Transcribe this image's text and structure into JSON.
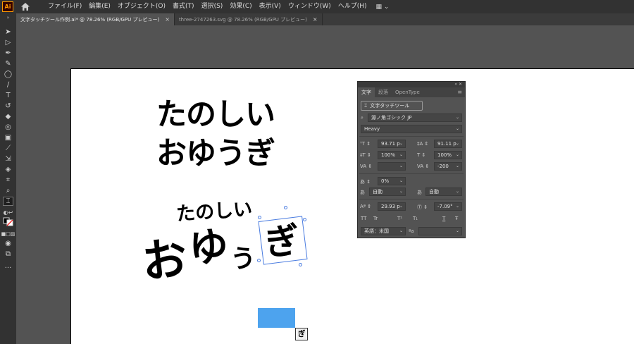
{
  "app": {
    "logo": "Ai"
  },
  "menu": {
    "items": [
      "ファイル(F)",
      "編集(E)",
      "オブジェクト(O)",
      "書式(T)",
      "選択(S)",
      "効果(C)",
      "表示(V)",
      "ウィンドウ(W)",
      "ヘルプ(H)"
    ]
  },
  "tabs": [
    {
      "label": "文字タッチツール作例.ai* @ 78.26% (RGB/GPU プレビュー)",
      "close": "×"
    },
    {
      "label": "three-2747263.svg @ 78.26% (RGB/GPU プレビュー)",
      "close": "×"
    }
  ],
  "artwork": {
    "line1": "たのしい",
    "line2": "おゆうぎ",
    "touch_line1": "たのしい",
    "touch_o": "お",
    "touch_yu": "ゆ",
    "touch_u": "う",
    "touch_gi": "ぎ",
    "tag": "ぎ"
  },
  "panel": {
    "tabs": [
      "文字",
      "段落",
      "OpenType"
    ],
    "touch_tool_label": "文字タッチツール",
    "font_family": "源ノ角ゴシック JP",
    "font_style": "Heavy",
    "font_size": "93.71 p",
    "leading": "91.11 p",
    "vertical_scale": "100%",
    "horizontal_scale": "100%",
    "kerning": "",
    "tracking": "-200",
    "tsume": "0%",
    "aki_left": "自動",
    "aki_right": "自動",
    "baseline_shift": "29.93 p",
    "rotation": "-7.09°",
    "language": "英語：米国",
    "options": [
      "TT",
      "Tr",
      "T¹",
      "T₁",
      "T",
      "Ŧ"
    ]
  },
  "colors": {
    "accent": "#4da3ee",
    "selection": "#4a7ce0",
    "ai_brand": "#ff9a00"
  }
}
